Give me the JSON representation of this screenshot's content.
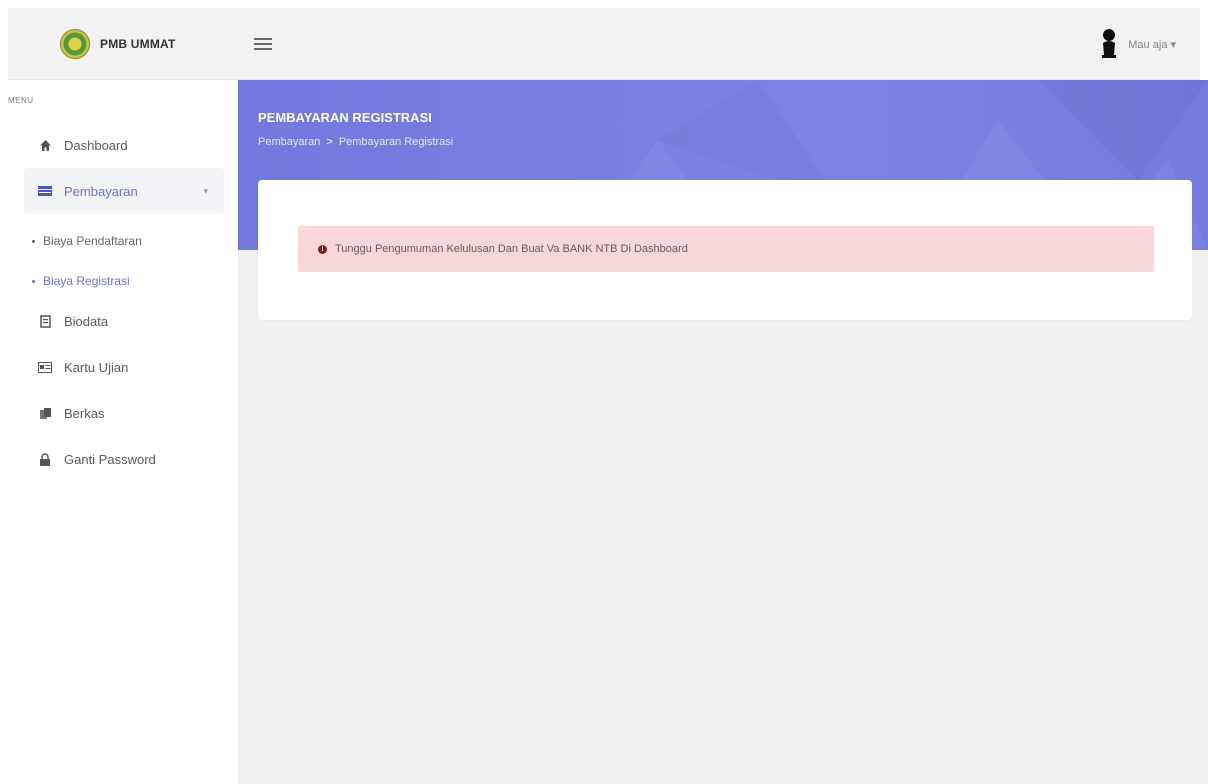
{
  "header": {
    "brand": "PMB UMMAT",
    "user_name": "Mau aja",
    "user_caret": "▾"
  },
  "sidebar": {
    "menu_label": "MENU",
    "items": [
      {
        "label": "Dashboard",
        "icon": "home-icon"
      },
      {
        "label": "Pembayaran",
        "icon": "credit-card-icon",
        "active": true
      },
      {
        "label": "Biodata",
        "icon": "file-icon"
      },
      {
        "label": "Kartu Ujian",
        "icon": "id-card-icon"
      },
      {
        "label": "Berkas",
        "icon": "files-icon"
      },
      {
        "label": "Ganti Password",
        "icon": "lock-icon"
      }
    ],
    "submenu": [
      {
        "label": "Biaya Pendaftaran"
      },
      {
        "label": "Biaya Registrasi",
        "active": true
      }
    ]
  },
  "page": {
    "title": "PEMBAYARAN REGISTRASI",
    "breadcrumb": [
      "Pembayaran",
      "Pembayaran Registrasi"
    ],
    "breadcrumb_sep": ">"
  },
  "alert": {
    "message": "Tunggu Pengumuman Kelulusan Dan Buat Va BANK NTB Di Dashboard"
  },
  "colors": {
    "banner": "#7378de",
    "accent": "#6a72d8",
    "alert_bg": "#f8d7da"
  }
}
